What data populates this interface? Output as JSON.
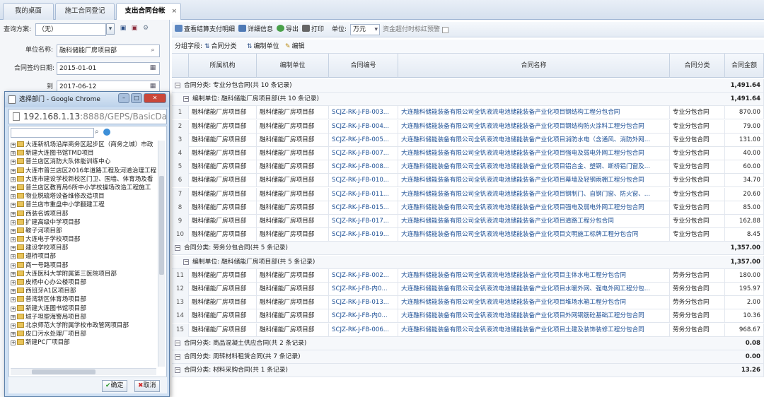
{
  "tabs": [
    {
      "label": "我的桌面"
    },
    {
      "label": "施工合同登记"
    },
    {
      "label": "支出合同台帐",
      "close": "×"
    }
  ],
  "query": {
    "scheme_label": "查询方案:",
    "scheme_value": "（无）",
    "unit_label": "单位名称:",
    "unit_value": "融科储能厂房项目部",
    "date_label": "合同签约日期:",
    "date_from": "2015-01-01",
    "to_label": "到",
    "date_to": "2017-06-12"
  },
  "toolbar": {
    "view_detail": "查看结算支付明细",
    "detail_info": "详细信息",
    "export": "导出",
    "print": "打印",
    "unit_label": "单位:",
    "unit_value": "万元",
    "warning_label": "资金超付时标红预警"
  },
  "grouping": {
    "label": "分组字段:",
    "field1": "合同分类",
    "field2": "编制单位",
    "edit": "编辑"
  },
  "columns": [
    "所属机构",
    "编制单位",
    "合同编号",
    "合同名称",
    "合同分类",
    "合同金额"
  ],
  "groups": {
    "g1": {
      "label": "合同分类: 专业分包合同(共 10 条记录)",
      "total": "1,491.64"
    },
    "g1s": {
      "label": "编制单位: 融科储能厂房项目部(共 10 条记录)",
      "total": "1,491.64"
    },
    "g2": {
      "label": "合同分类: 劳务分包合同(共 5 条记录)",
      "total": "1,357.00"
    },
    "g2s": {
      "label": "编制单位: 融科储能厂房项目部(共 5 条记录)",
      "total": "1,357.00"
    },
    "g3": {
      "label": "合同分类: 商品混凝土供应合同(共 2 条记录)",
      "total": "0.08"
    },
    "g4": {
      "label": "合同分类: 周转材料租赁合同(共 7 条记录)",
      "total": "0.00"
    },
    "g5": {
      "label": "合同分类: 材料采购合同(共 1 条记录)",
      "total": "13.26"
    }
  },
  "rows": [
    [
      "1",
      "融科储能厂房项目部",
      "融科储能厂房项目部",
      "SCJZ-RK-J-FB-003...",
      "大连融科储能装备有限公司全钒液流电池储能装备产业化项目钢结构工程分包合同",
      "专业分包合同",
      "870.00"
    ],
    [
      "2",
      "融科储能厂房项目部",
      "融科储能厂房项目部",
      "SCJZ-RK-J-FB-004...",
      "大连融科储能装备有限公司全钒液流电池储能装备产业化项目钢结构防火涂料工程分包合同",
      "专业分包合同",
      "79.00"
    ],
    [
      "3",
      "融科储能厂房项目部",
      "融科储能厂房项目部",
      "SCJZ-RK-J-FB-005...",
      "大连融科储能装备有限公司全钒液流电池储能装备产业化项目消防水电（含通风、消防外网...",
      "专业分包合同",
      "131.00"
    ],
    [
      "4",
      "融科储能厂房项目部",
      "融科储能厂房项目部",
      "SCJZ-RK-J-FB-007...",
      "大连融科储能装备有限公司全钒液流电池储能装备产业化项目强电及弱电外网工程分包合同",
      "专业分包合同",
      "40.00"
    ],
    [
      "5",
      "融科储能厂房项目部",
      "融科储能厂房项目部",
      "SCJZ-RK-J-FB-008...",
      "大连融科储能装备有限公司全钒液流电池储能装备产业化项目铝合金、塑钢、断桥铝门窗及...",
      "专业分包合同",
      "60.00"
    ],
    [
      "6",
      "融科储能厂房项目部",
      "融科储能厂房项目部",
      "SCJZ-RK-J-FB-010...",
      "大连融科储能装备有限公司全钒液流电池储能装备产业化项目幕墙及轻钢雨棚工程分包合同",
      "专业分包合同",
      "34.70"
    ],
    [
      "7",
      "融科储能厂房项目部",
      "融科储能厂房项目部",
      "SCJZ-RK-J-FB-011...",
      "大连融科储能装备有限公司全钒液流电池储能装备产业化项目钢制门、自钢门窗、防火窗、...",
      "专业分包合同",
      "20.60"
    ],
    [
      "8",
      "融科储能厂房项目部",
      "融科储能厂房项目部",
      "SCJZ-RK-J-FB-015...",
      "大连融科储能装备有限公司全钒液流电池储能装备产业化项目强电及弱电外网工程分包合同",
      "专业分包合同",
      "85.00"
    ],
    [
      "9",
      "融科储能厂房项目部",
      "融科储能厂房项目部",
      "SCJZ-RK-J-FB-017...",
      "大连融科储能装备有限公司全钒液流电池储能装备产业化项目道路工程分包合同",
      "专业分包合同",
      "162.88"
    ],
    [
      "10",
      "融科储能厂房项目部",
      "融科储能厂房项目部",
      "SCJZ-RK-J-FB-019...",
      "大连融科储能装备有限公司全钒液流电池储能装备产业化项目文明施工标牌工程分包合同",
      "专业分包合同",
      "8.45"
    ],
    [
      "11",
      "融科储能厂房项目部",
      "融科储能厂房项目部",
      "SCJZ-RK-J-FB-002...",
      "大连融科储能装备有限公司全钒液流电池储能装备产业化项目主体水电工程分包合同",
      "劳务分包合同",
      "180.00"
    ],
    [
      "12",
      "融科储能厂房项目部",
      "融科储能厂房项目部",
      "SCJZ-RK-J-FB-内0...",
      "大连融科储能装备有限公司全钒液流电池储能装备产业化项目水暖外网、强电外网工程分包...",
      "劳务分包合同",
      "195.97"
    ],
    [
      "13",
      "融科储能厂房项目部",
      "融科储能厂房项目部",
      "SCJZ-RK-J-FB-013...",
      "大连融科储能装备有限公司全钒液流电池储能装备产业化项目堆场水箱工程分包合同",
      "劳务分包合同",
      "2.00"
    ],
    [
      "14",
      "融科储能厂房项目部",
      "融科储能厂房项目部",
      "SCJZ-RK-J-FB-内0...",
      "大连融科储能装备有限公司全钒液流电池储能装备产业化项目外网钢筋砼基础工程分包合同",
      "劳务分包合同",
      "10.36"
    ],
    [
      "15",
      "融科储能厂房项目部",
      "融科储能厂房项目部",
      "SCJZ-RK-J-FB-006...",
      "大连融科储能装备有限公司全钒液流电池储能装备产业化项目土建及装饰装修工程分包合同",
      "劳务分包合同",
      "968.67"
    ]
  ],
  "popup": {
    "title": "选择部门 - Google Chrome",
    "address_host": "192.168.1.13",
    "address_path": ":8888/GEPS/BasicData/",
    "ok": "确定",
    "cancel": "取消",
    "tree": [
      "大连新机场沿岸商务区起步区（商务之城）市政",
      "新建大连图书馆TMD项目",
      "普兰店区消防大队体能训练中心",
      "大连市普兰店区2016年道路工程及河道治理工程",
      "大连市建设学校新校区门卫、围墙、体育场及看",
      "普兰店区教育局6所中小学校操场改造工程施工",
      "物业脱硫塔设备维修改造项目",
      "普兰店市重盘中小学翻建工程",
      "西装名城项目部",
      "扩建高级中学项目部",
      "鞍子河项目部",
      "大连电子学校项目部",
      "建设学校项目部",
      "遵桥项目部",
      "商一号路项目部",
      "大连医科大学附属第三医院项目部",
      "皮杨中心办公楼项目部",
      "西班牙A1区项目部",
      "普湾新区体育场项目部",
      "新建大连图书馆项目部",
      "城子坦塑海警局项目部",
      "北京师范大学附属学校市政管网项目部",
      "皮口污水处理厂项目部",
      "新建PC厂项目部"
    ]
  }
}
